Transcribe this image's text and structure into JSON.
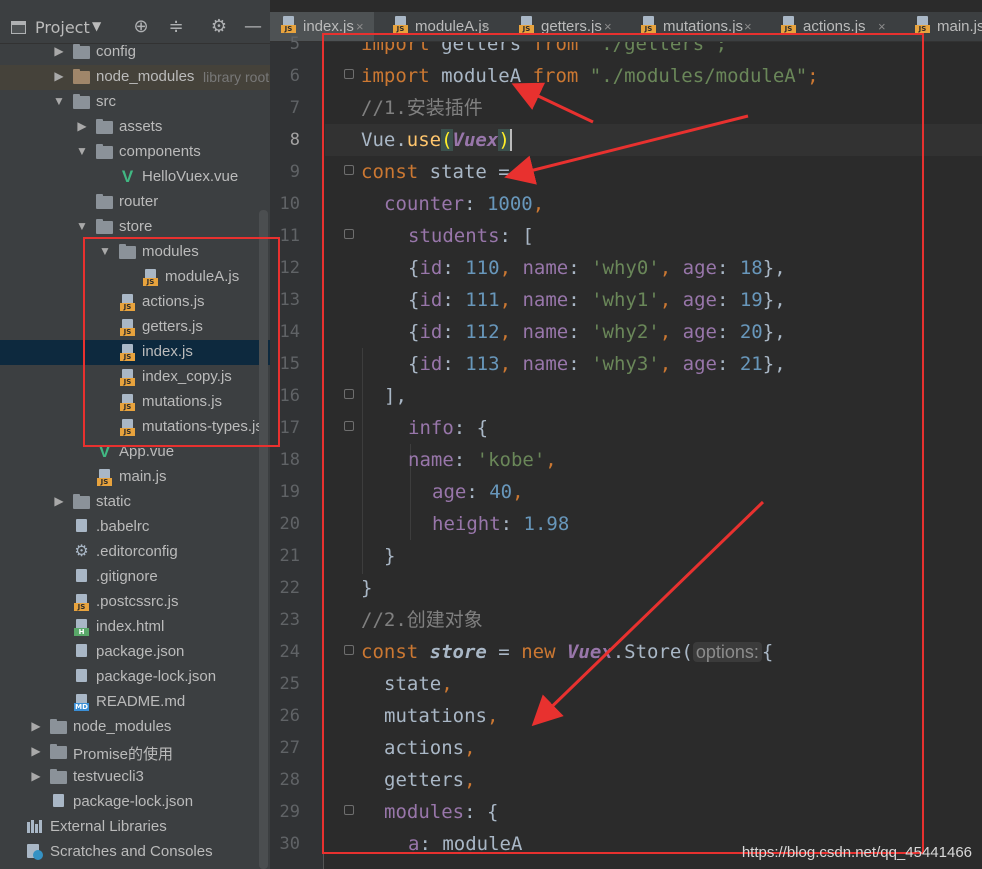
{
  "project_panel": {
    "title": "Project",
    "dropdown_icon": "chevron-down-icon",
    "tree": [
      {
        "label": "config",
        "icon": "folder-icon",
        "expanded": false
      },
      {
        "label": "node_modules",
        "hint": "library root",
        "icon": "folder-icon",
        "expanded": false
      },
      {
        "label": "src",
        "icon": "folder-icon",
        "expanded": true
      },
      {
        "label": "assets",
        "icon": "folder-icon",
        "expanded": false
      },
      {
        "label": "components",
        "icon": "folder-icon",
        "expanded": true
      },
      {
        "label": "HelloVuex.vue",
        "icon": "vue-file-icon"
      },
      {
        "label": "router",
        "icon": "folder-icon"
      },
      {
        "label": "store",
        "icon": "folder-icon",
        "expanded": true
      },
      {
        "label": "modules",
        "icon": "folder-icon",
        "expanded": true
      },
      {
        "label": "moduleA.js",
        "icon": "js-file-icon"
      },
      {
        "label": "actions.js",
        "icon": "js-file-icon"
      },
      {
        "label": "getters.js",
        "icon": "js-file-icon"
      },
      {
        "label": "index.js",
        "icon": "js-file-icon",
        "selected": true
      },
      {
        "label": "index_copy.js",
        "icon": "js-file-icon"
      },
      {
        "label": "mutations.js",
        "icon": "js-file-icon"
      },
      {
        "label": "mutations-types.js",
        "icon": "js-file-icon"
      },
      {
        "label": "App.vue",
        "icon": "vue-file-icon"
      },
      {
        "label": "main.js",
        "icon": "js-file-icon"
      },
      {
        "label": "static",
        "icon": "folder-icon",
        "expanded": false
      },
      {
        "label": ".babelrc",
        "icon": "config-file-icon"
      },
      {
        "label": ".editorconfig",
        "icon": "gear-icon"
      },
      {
        "label": ".gitignore",
        "icon": "config-file-icon"
      },
      {
        "label": ".postcssrc.js",
        "icon": "js-file-icon"
      },
      {
        "label": "index.html",
        "icon": "html-file-icon"
      },
      {
        "label": "package.json",
        "icon": "config-file-icon"
      },
      {
        "label": "package-lock.json",
        "icon": "config-file-icon"
      },
      {
        "label": "README.md",
        "icon": "markdown-file-icon"
      },
      {
        "label": "node_modules",
        "icon": "folder-icon",
        "expanded": false
      },
      {
        "label": "Promise的使用",
        "icon": "folder-icon",
        "expanded": false
      },
      {
        "label": "testvuecli3",
        "icon": "folder-icon",
        "expanded": false
      },
      {
        "label": "package-lock.json",
        "icon": "config-file-icon"
      },
      {
        "label": "External Libraries",
        "icon": "library-icon"
      },
      {
        "label": "Scratches and Consoles",
        "icon": "scratches-icon"
      }
    ]
  },
  "editor_tabs": [
    {
      "label": "index.js",
      "icon": "js-file-icon",
      "active": true
    },
    {
      "label": "moduleA.js",
      "icon": "js-file-icon"
    },
    {
      "label": "getters.js",
      "icon": "js-file-icon"
    },
    {
      "label": "mutations.js",
      "icon": "js-file-icon"
    },
    {
      "label": "actions.js",
      "icon": "js-file-icon"
    },
    {
      "label": "main.js",
      "icon": "js-file-icon"
    }
  ],
  "editor": {
    "current_line": 8,
    "line_numbers": [
      "5",
      "6",
      "7",
      "8",
      "9",
      "10",
      "11",
      "12",
      "13",
      "14",
      "15",
      "16",
      "17",
      "18",
      "19",
      "20",
      "21",
      "22",
      "23",
      "24",
      "25",
      "26",
      "27",
      "28",
      "29",
      "30"
    ],
    "code": {
      "l5": {
        "kw1": "import",
        "id": " getters ",
        "kw2": "from",
        "str": " './getters';"
      },
      "l6": {
        "kw1": "import",
        "id": " moduleA ",
        "kw2": "from",
        "str": " \"./modules/moduleA\"",
        "semi": ";"
      },
      "l7": {
        "comment": "//1.安装插件"
      },
      "l8": {
        "obj": "Vue.",
        "fn": "use",
        "open": "(",
        "arg": "Vuex",
        "close": ")"
      },
      "l9": {
        "kw": "const",
        "rest": " state = {"
      },
      "l10": {
        "prop": "counter",
        "colon": ": ",
        "num": "1000",
        "comma": ","
      },
      "l11": {
        "prop": "students",
        "rest": ": ["
      },
      "l12": {
        "id1": "{",
        "p1": "id",
        "v1": "110",
        "p2": "name",
        "v2": "'why0'",
        "p3": "age",
        "v3": "18",
        "end": "},"
      },
      "l13": {
        "id1": "{",
        "p1": "id",
        "v1": "111",
        "p2": "name",
        "v2": "'why1'",
        "p3": "age",
        "v3": "19",
        "end": "},"
      },
      "l14": {
        "id1": "{",
        "p1": "id",
        "v1": "112",
        "p2": "name",
        "v2": "'why2'",
        "p3": "age",
        "v3": "20",
        "end": "},"
      },
      "l15": {
        "id1": "{",
        "p1": "id",
        "v1": "113",
        "p2": "name",
        "v2": "'why3'",
        "p3": "age",
        "v3": "21",
        "end": "},"
      },
      "l16": {
        "text": "],"
      },
      "l17": {
        "prop": "info",
        "rest": ": {"
      },
      "l18": {
        "prop": "name",
        "colon": ": ",
        "str": "'kobe'",
        "comma": ","
      },
      "l19": {
        "prop": "age",
        "colon": ": ",
        "num": "40",
        "comma": ","
      },
      "l20": {
        "prop": "height",
        "colon": ": ",
        "num": "1.98"
      },
      "l21": {
        "text": "}"
      },
      "l22": {
        "text": "}"
      },
      "l23": {
        "comment": "//2.创建对象"
      },
      "l24": {
        "kw": "const",
        "var": "store",
        "eq": " = ",
        "kw2": "new",
        "cls": "Vuex",
        "dot": ".Store(",
        "hint": "options:",
        "open": "{"
      },
      "l25": {
        "id": "state",
        "comma": ","
      },
      "l26": {
        "id": "mutations",
        "comma": ","
      },
      "l27": {
        "id": "actions",
        "comma": ","
      },
      "l28": {
        "id": "getters",
        "comma": ","
      },
      "l29": {
        "prop": "modules",
        "rest": ": {"
      },
      "l30": {
        "prop": "a",
        "rest": ": moduleA"
      }
    }
  },
  "annotation": {
    "color": "#e8312f"
  },
  "watermark": "https://blog.csdn.net/qq_45441466"
}
